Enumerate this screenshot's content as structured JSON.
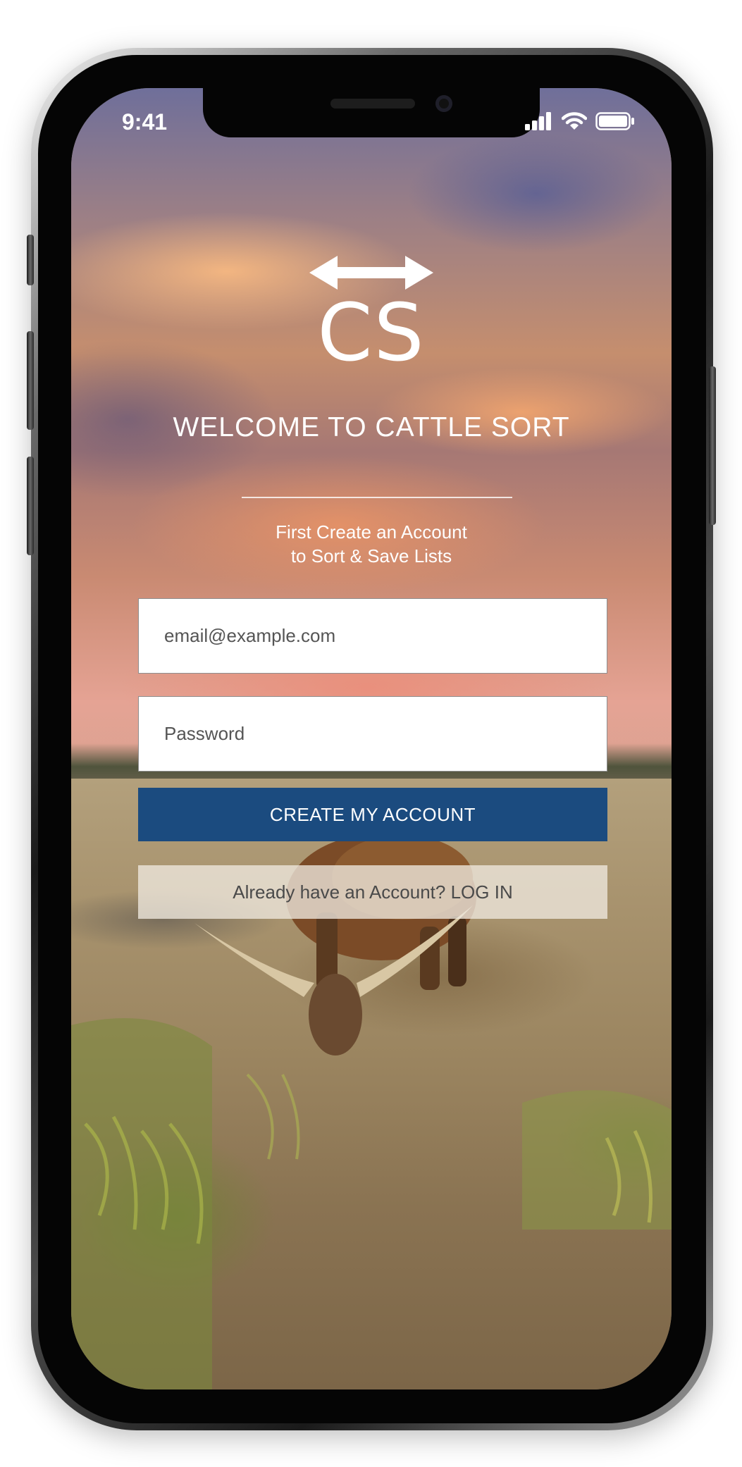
{
  "status_bar": {
    "time": "9:41",
    "icons": [
      "signal-icon",
      "wifi-icon",
      "battery-icon"
    ]
  },
  "app": {
    "logo_text": "CS",
    "logo_icon": "double-arrow-icon",
    "welcome": "WELCOME TO CATTLE SORT",
    "subtitle_line1": "First Create an Account",
    "subtitle_line2": "to Sort & Save Lists"
  },
  "form": {
    "email_placeholder": "email@example.com",
    "password_placeholder": "Password",
    "create_label": "CREATE MY ACCOUNT",
    "login_label": "Already have an Account? LOG IN"
  },
  "colors": {
    "primary": "#1b4b7f",
    "text_light": "#ffffff",
    "secondary_button": "#eee8de"
  }
}
